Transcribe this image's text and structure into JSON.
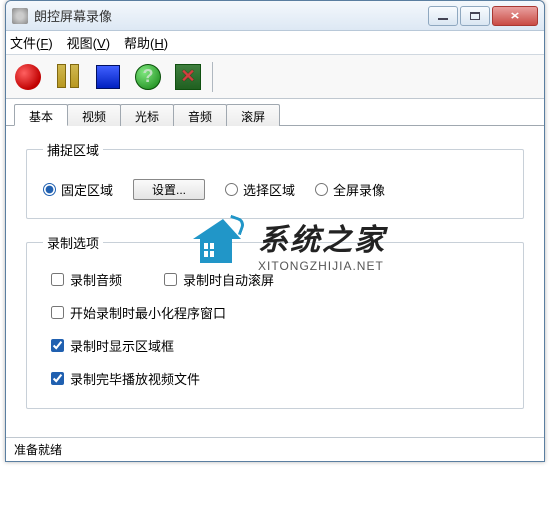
{
  "window": {
    "title": "朗控屏幕录像"
  },
  "menu": {
    "file": {
      "label": "文件",
      "accel": "F"
    },
    "view": {
      "label": "视图",
      "accel": "V"
    },
    "help": {
      "label": "帮助",
      "accel": "H"
    }
  },
  "toolbar": {
    "help_glyph": "?",
    "close_glyph": "✕"
  },
  "tabs": [
    {
      "id": "basic",
      "label": "基本",
      "active": true
    },
    {
      "id": "video",
      "label": "视频",
      "active": false
    },
    {
      "id": "cursor",
      "label": "光标",
      "active": false
    },
    {
      "id": "audio",
      "label": "音频",
      "active": false
    },
    {
      "id": "scroll",
      "label": "滚屏",
      "active": false
    }
  ],
  "capture": {
    "legend": "捕捉区域",
    "fixed": {
      "label": "固定区域",
      "selected": true
    },
    "settings_btn": "设置...",
    "select": {
      "label": "选择区域",
      "selected": false
    },
    "fullscreen": {
      "label": "全屏录像",
      "selected": false
    }
  },
  "options": {
    "legend": "录制选项",
    "record_audio": {
      "label": "录制音频",
      "checked": false
    },
    "auto_scroll": {
      "label": "录制时自动滚屏",
      "checked": false
    },
    "minimize_on_start": {
      "label": "开始录制时最小化程序窗口",
      "checked": false
    },
    "show_region": {
      "label": "录制时显示区域框",
      "checked": true
    },
    "play_when_done": {
      "label": "录制完毕播放视频文件",
      "checked": true
    }
  },
  "status": {
    "text": "准备就绪"
  },
  "watermark": {
    "cn": "系统之家",
    "en": "XITONGZHIJIA.NET"
  }
}
